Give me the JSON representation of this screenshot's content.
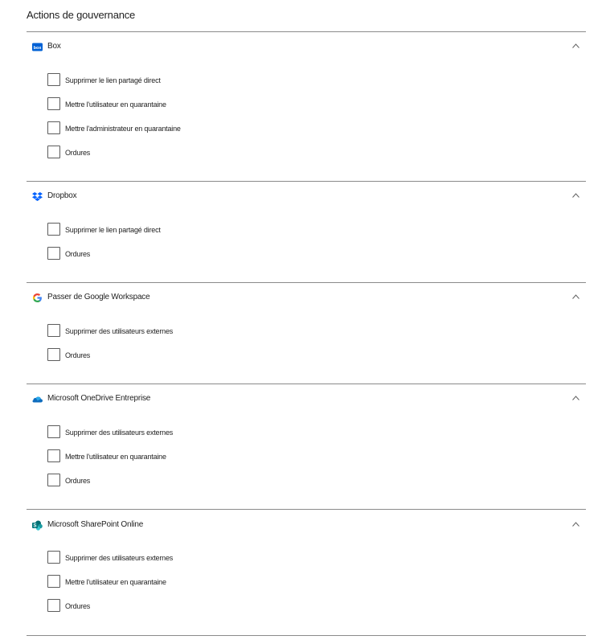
{
  "page": {
    "title": "Actions de gouvernance"
  },
  "colors": {
    "divider": "#8a8a8a",
    "box_brand": "#0061d5",
    "dropbox_brand": "#0061fe",
    "onedrive_brand": "#0f6cbd",
    "sharepoint_brand": "#03787c"
  },
  "sections": [
    {
      "app": "Box",
      "icon": "box-logo-icon",
      "expanded": true,
      "options": [
        {
          "label": "Supprimer le lien partagé direct",
          "checked": false
        },
        {
          "label": "Mettre l'utilisateur en quarantaine",
          "checked": false
        },
        {
          "label": "Mettre l'administrateur en quarantaine",
          "checked": false
        },
        {
          "label": "Ordures",
          "checked": false
        }
      ]
    },
    {
      "app": "Dropbox",
      "icon": "dropbox-logo-icon",
      "expanded": true,
      "options": [
        {
          "label": "Supprimer le lien partagé direct",
          "checked": false
        },
        {
          "label": "Ordures",
          "checked": false
        }
      ]
    },
    {
      "app": "Passer de Google Workspace",
      "icon": "google-logo-icon",
      "expanded": true,
      "options": [
        {
          "label": "Supprimer des utilisateurs externes",
          "checked": false
        },
        {
          "label": "Ordures",
          "checked": false
        }
      ]
    },
    {
      "app": "Microsoft OneDrive Entreprise",
      "icon": "onedrive-logo-icon",
      "expanded": true,
      "options": [
        {
          "label": "Supprimer des utilisateurs externes",
          "checked": false
        },
        {
          "label": "Mettre l'utilisateur en quarantaine",
          "checked": false
        },
        {
          "label": "Ordures",
          "checked": false
        }
      ]
    },
    {
      "app": "Microsoft SharePoint Online",
      "icon": "sharepoint-logo-icon",
      "expanded": true,
      "options": [
        {
          "label": "Supprimer des utilisateurs externes",
          "checked": false
        },
        {
          "label": "Mettre l'utilisateur en quarantaine",
          "checked": false
        },
        {
          "label": "Ordures",
          "checked": false
        }
      ]
    }
  ]
}
